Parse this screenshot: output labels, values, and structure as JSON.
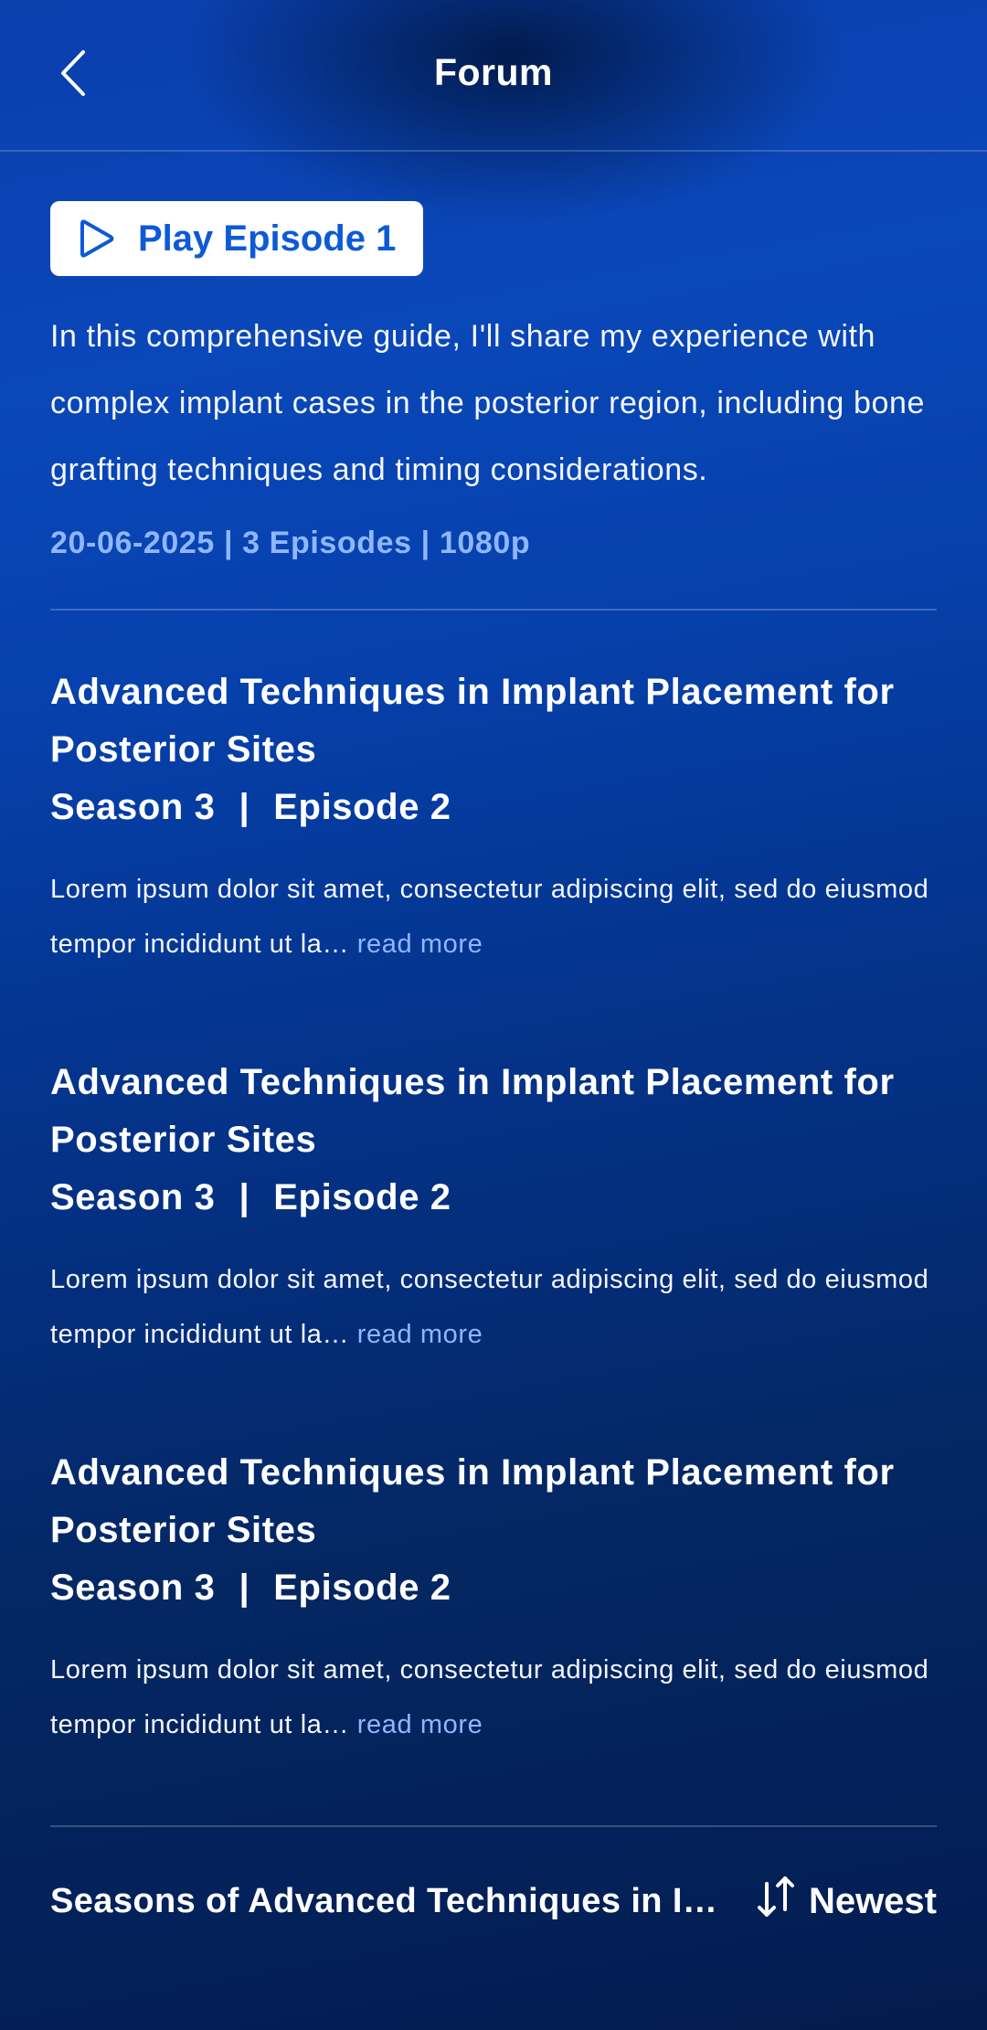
{
  "header": {
    "title": "Forum",
    "back_icon": "chevron-left-icon"
  },
  "hero": {
    "play_label": "Play Episode 1",
    "play_icon": "play-icon",
    "description": "In this comprehensive guide, I'll share my experience with complex implant cases in the posterior region, including bone grafting techniques and timing considerations.",
    "meta": "20-06-2025 | 3 Episodes | 1080p"
  },
  "episodes": [
    {
      "title": "Advanced Techniques in Implant Placement for Posterior Sites",
      "season": "Season 3",
      "episode": "Episode 2",
      "excerpt": "Lorem ipsum dolor sit amet, consectetur adipiscing elit, sed do eiusmod tempor incididunt ut la…",
      "read_more": "read more"
    },
    {
      "title": "Advanced Techniques in Implant Placement for Posterior Sites",
      "season": "Season 3",
      "episode": "Episode 2",
      "excerpt": "Lorem ipsum dolor sit amet, consectetur adipiscing elit, sed do eiusmod tempor incididunt ut la…",
      "read_more": "read more"
    },
    {
      "title": "Advanced Techniques in Implant Placement for Posterior Sites",
      "season": "Season 3",
      "episode": "Episode 2",
      "excerpt": "Lorem ipsum dolor sit amet, consectetur adipiscing elit, sed do eiusmod tempor incididunt ut la…",
      "read_more": "read more"
    }
  ],
  "seasons": {
    "title": "Seasons of Advanced Techniques in Implant Placement for Posterior Sites",
    "sort_label": "Newest",
    "sort_icon": "sort-arrows-icon"
  },
  "colors": {
    "accent": "#0d5ad6",
    "link": "#8fb6ff",
    "background_top": "#0a47b8",
    "background_bottom": "#031c4f"
  }
}
